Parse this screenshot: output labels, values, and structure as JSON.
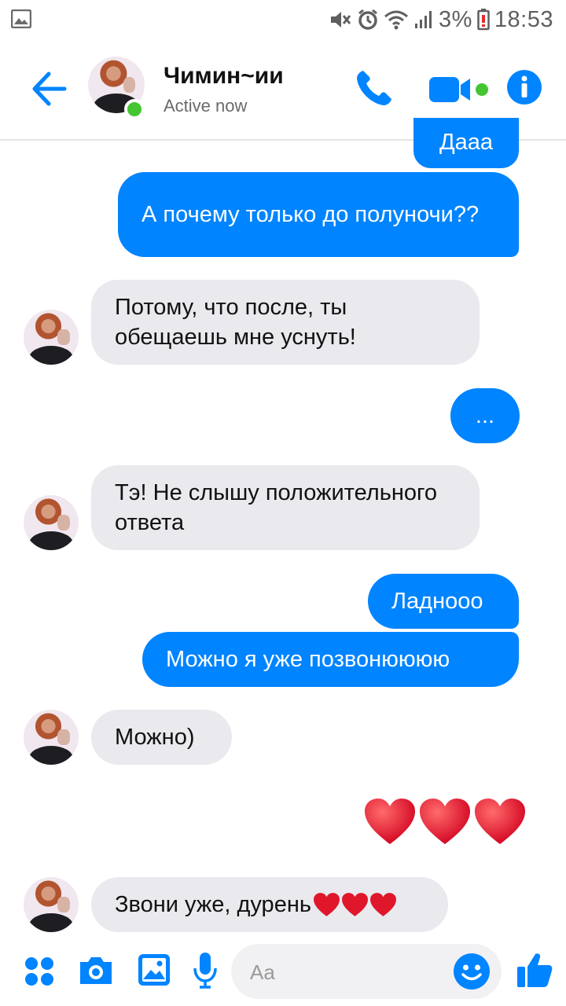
{
  "status_bar": {
    "battery": "3%",
    "time": "18:53"
  },
  "header": {
    "contact_name": "Чимин~ии",
    "status": "Active now"
  },
  "messages": [
    {
      "from": "me",
      "text": "Дааа"
    },
    {
      "from": "me",
      "text": "А почему только до полуночи??"
    },
    {
      "from": "them",
      "text": "Потому, что после, ты обещаешь мне уснуть!"
    },
    {
      "from": "me",
      "text": "..."
    },
    {
      "from": "them",
      "text": "Тэ! Не слышу положительного ответа"
    },
    {
      "from": "me",
      "text": "Ладнооо"
    },
    {
      "from": "me",
      "text": "Можно я уже позвонюююю"
    },
    {
      "from": "them",
      "text": "Можно)"
    },
    {
      "from": "me",
      "text": "❤️❤️❤️"
    },
    {
      "from": "them",
      "text": "Звони уже, дурень"
    }
  ],
  "composer": {
    "placeholder": "Aa"
  },
  "colors": {
    "accent": "#0084ff",
    "incoming": "#e9e9ee",
    "online": "#43c631"
  }
}
